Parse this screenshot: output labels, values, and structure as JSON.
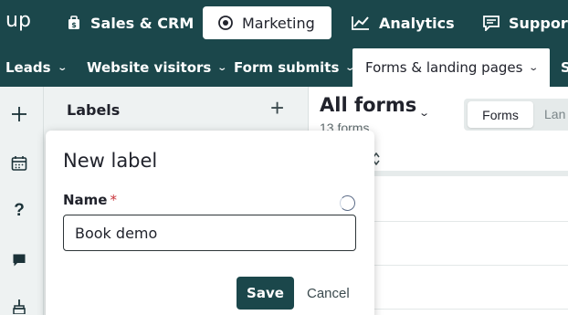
{
  "brand": {
    "text": "up"
  },
  "topnav": {
    "tabs": [
      {
        "label": "Sales & CRM",
        "icon": "briefcase-icon"
      },
      {
        "label": "Marketing",
        "icon": "target-icon",
        "active": true
      },
      {
        "label": "Analytics",
        "icon": "line-chart-icon"
      },
      {
        "label": "Support",
        "icon": "chat-icon"
      }
    ]
  },
  "subnav": {
    "tabs": [
      {
        "label": "Leads"
      },
      {
        "label": "Website visitors"
      },
      {
        "label": "Form submits"
      },
      {
        "label": "Forms & landing pages",
        "active": true
      },
      {
        "label": "S"
      }
    ]
  },
  "rail": {
    "icons": [
      "plus-icon",
      "calendar-icon",
      "help-icon",
      "comment-icon",
      "broom-icon"
    ],
    "help_text": "?"
  },
  "labels_panel": {
    "title": "Labels",
    "add_symbol": "+"
  },
  "main": {
    "title": "All forms",
    "count": "13 forms",
    "segment": {
      "active": "Forms",
      "other": "Lan"
    }
  },
  "modal": {
    "title": "New label",
    "field_label": "Name",
    "required_mark": "*",
    "input_value": "Book demo",
    "save_label": "Save",
    "cancel_label": "Cancel"
  },
  "colors": {
    "nav_bg": "#1b474b",
    "panel_bg": "#eef2f2",
    "accent": "#1b474b",
    "required": "#c8333a"
  }
}
